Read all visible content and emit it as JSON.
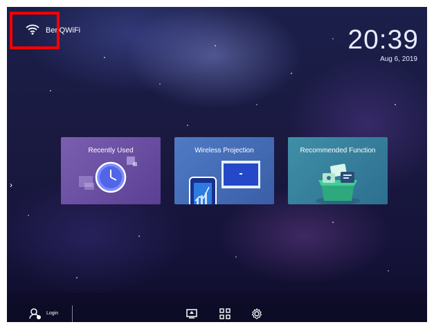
{
  "status": {
    "wifi_name": "BenQWiFi",
    "time": "20:39",
    "date": "Aug 6, 2019"
  },
  "cards": [
    {
      "title": "Recently Used",
      "icon": "clock-icon"
    },
    {
      "title": "Wireless Projection",
      "icon": "phone-to-screen-icon"
    },
    {
      "title": "Recommended Function",
      "icon": "gift-box-icon"
    }
  ],
  "bottom_bar": {
    "login_label": "Login",
    "icons": [
      "screen-mirror-icon",
      "apps-grid-icon",
      "settings-gear-icon"
    ]
  },
  "side_nav": {
    "arrow": "›"
  },
  "colors": {
    "highlight": "#ff0000"
  }
}
